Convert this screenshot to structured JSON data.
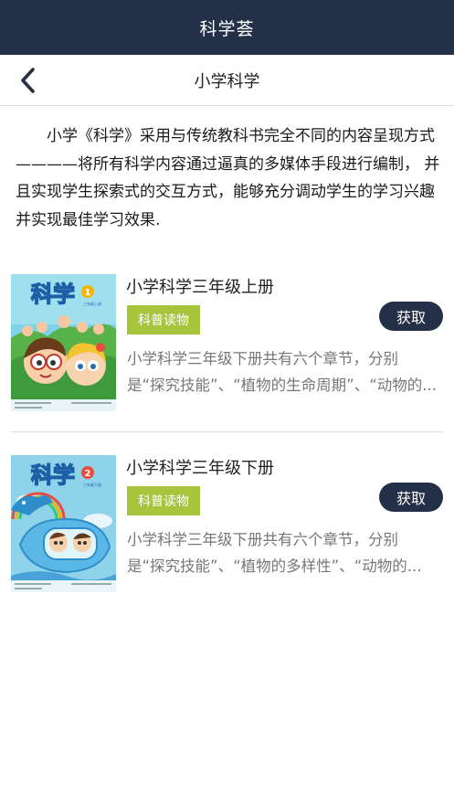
{
  "status_bar": {
    "title": "科学荟"
  },
  "nav": {
    "title": "小学科学"
  },
  "intro": {
    "text": "小学《科学》采用与传统教科书完全不同的内容呈现方式————将所有科学内容通过逼真的多媒体手段进行编制， 并且实现学生探索式的交互方式，能够充分调动学生的学习兴趣并实现最佳学习效果."
  },
  "books": [
    {
      "title": "小学科学三年级上册",
      "tag": "科普读物",
      "button": "获取",
      "desc_line1": "小学科学三年级下册共有六个章节，分别",
      "desc_line2": "是“探究技能”、“植物的生命周期”、“动物的...",
      "cover": {
        "title": "科学",
        "number": "1",
        "subtitle": "三年级上册"
      }
    },
    {
      "title": "小学科学三年级下册",
      "tag": "科普读物",
      "button": "获取",
      "desc_line1": "小学科学三年级下册共有六个章节，分别",
      "desc_line2": "是“探究技能”、“植物的多样性”、“动物的...",
      "cover": {
        "title": "科学",
        "number": "2",
        "subtitle": "三年级下册"
      }
    }
  ],
  "colors": {
    "header_bg": "#243047",
    "tag_bg": "#a6c53a",
    "button_bg": "#243047"
  }
}
